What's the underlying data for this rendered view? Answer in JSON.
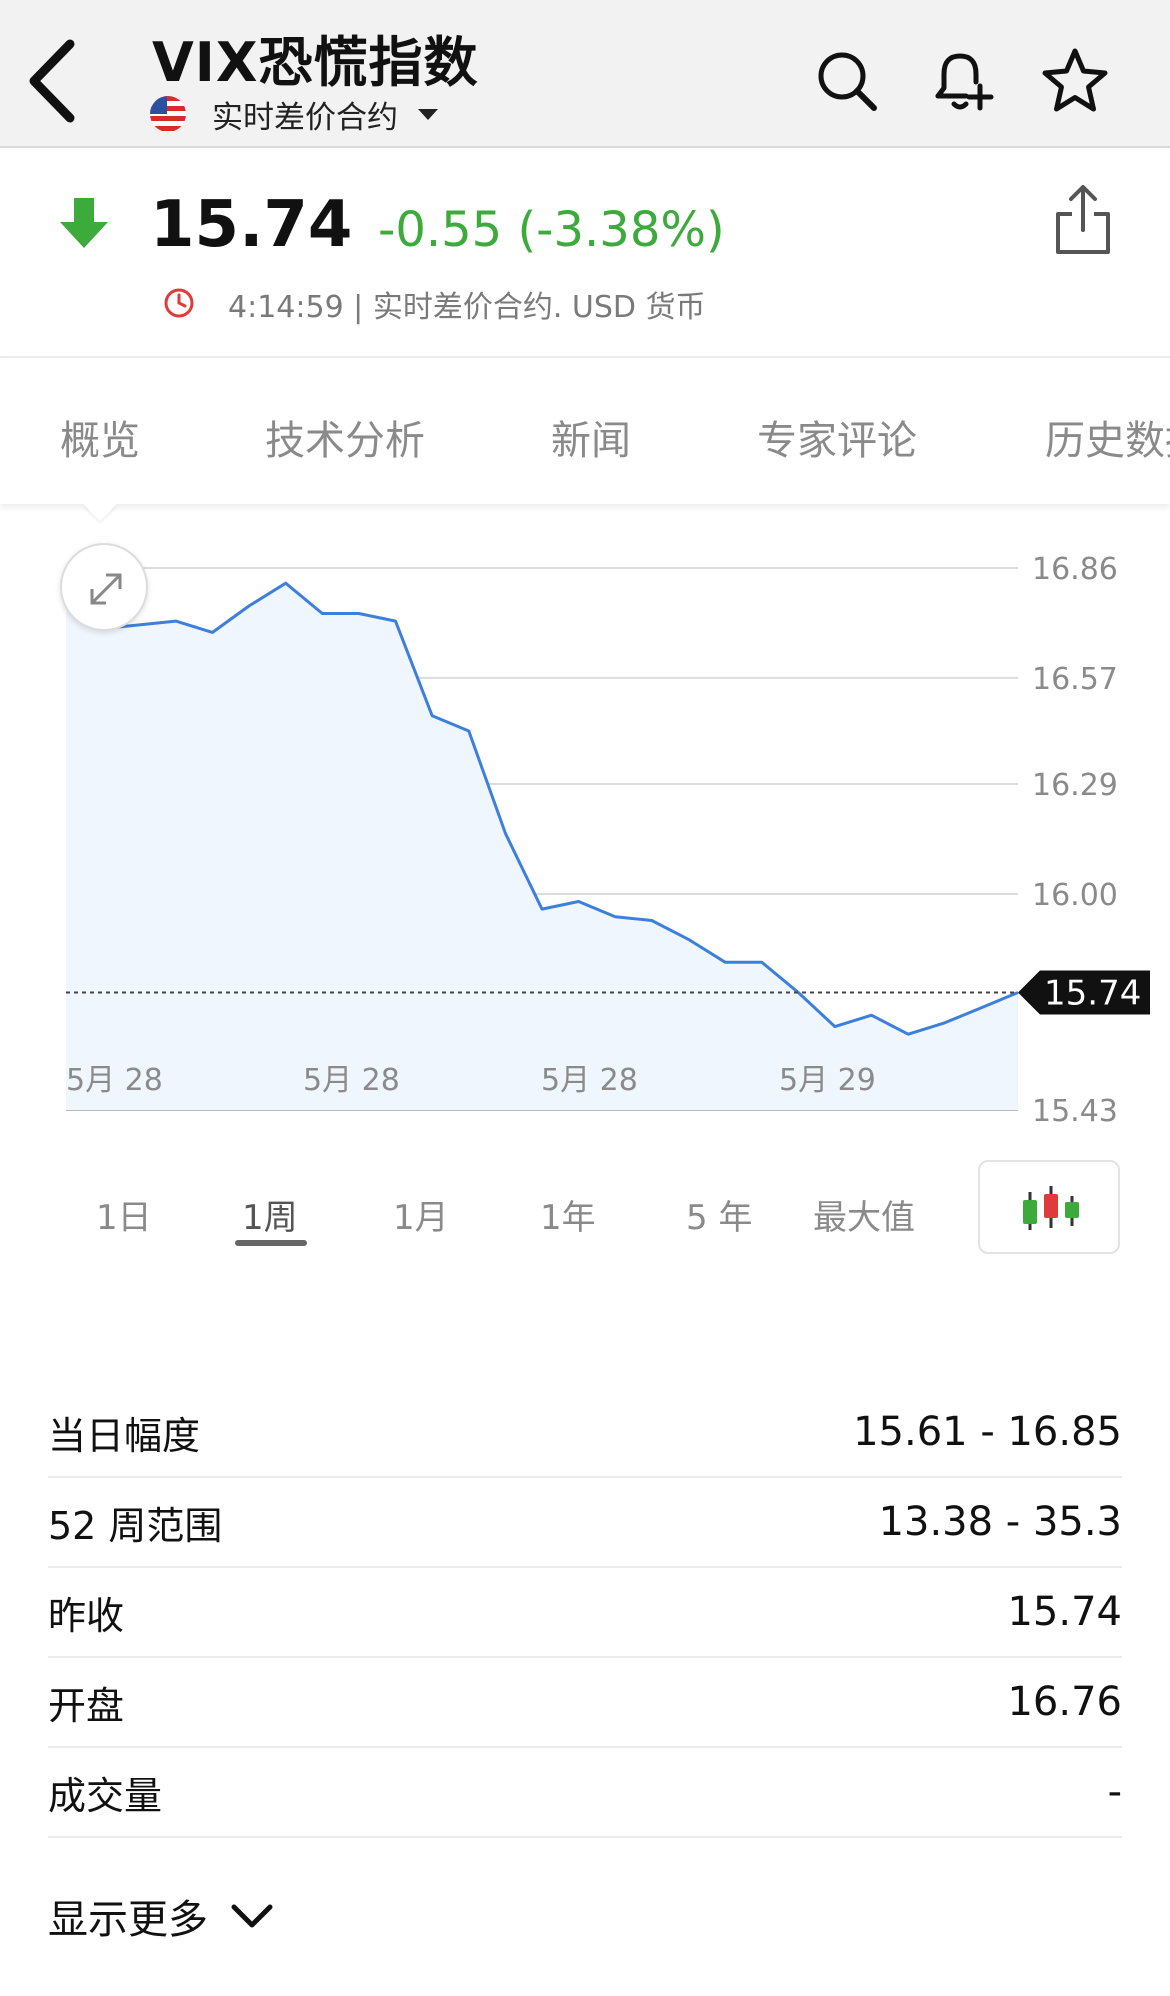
{
  "header": {
    "title": "VIX恐慌指数",
    "subtitle": "实时差价合约"
  },
  "quote": {
    "price": "15.74",
    "change": "-0.55 (-3.38%)",
    "meta": "4:14:59 | 实时差价合约.  USD 货币",
    "change_color": "#3cab3c",
    "down_arrow_color": "#3cab3c"
  },
  "tabs": [
    {
      "label": "概览",
      "active": true
    },
    {
      "label": "技术分析",
      "active": false
    },
    {
      "label": "新闻",
      "active": false
    },
    {
      "label": "专家评论",
      "active": false
    },
    {
      "label": "历史数据",
      "active": false
    }
  ],
  "ranges": [
    {
      "label": "1日",
      "active": false
    },
    {
      "label": "1周",
      "active": true
    },
    {
      "label": "1月",
      "active": false
    },
    {
      "label": "1年",
      "active": false
    },
    {
      "label": "5 年",
      "active": false
    },
    {
      "label": "最大值",
      "active": false
    }
  ],
  "chart_data": {
    "type": "area",
    "ylim": [
      15.43,
      16.86
    ],
    "y_ticks": [
      "16.86",
      "16.57",
      "16.29",
      "16.00",
      "15.43"
    ],
    "x_tick_labels": [
      "5月 28",
      "5月 28",
      "5月 28",
      "5月 29"
    ],
    "current_value": 15.74,
    "current_label": "15.74",
    "grid": true,
    "line_color": "#3d7fdc",
    "fill_color": "#f0f6fd",
    "values": [
      16.76,
      16.7,
      16.71,
      16.72,
      16.69,
      16.76,
      16.82,
      16.74,
      16.74,
      16.72,
      16.47,
      16.43,
      16.16,
      15.96,
      15.98,
      15.94,
      15.93,
      15.88,
      15.82,
      15.82,
      15.74,
      15.65,
      15.68,
      15.63,
      15.66,
      15.7,
      15.74
    ]
  },
  "stats": [
    {
      "label": "当日幅度",
      "value": "15.61 - 16.85"
    },
    {
      "label": "52 周范围",
      "value": "13.38 - 35.3"
    },
    {
      "label": "昨收",
      "value": "15.74"
    },
    {
      "label": "开盘",
      "value": "16.76"
    },
    {
      "label": "成交量",
      "value": "-"
    }
  ],
  "show_more": "显示更多",
  "icons": {
    "back": "chevron-left-icon",
    "search": "search-icon",
    "alert": "bell-plus-icon",
    "watch": "star-icon",
    "share": "share-icon",
    "clock": "clock-icon",
    "expand": "expand-icon",
    "candles": "candlestick-icon"
  }
}
